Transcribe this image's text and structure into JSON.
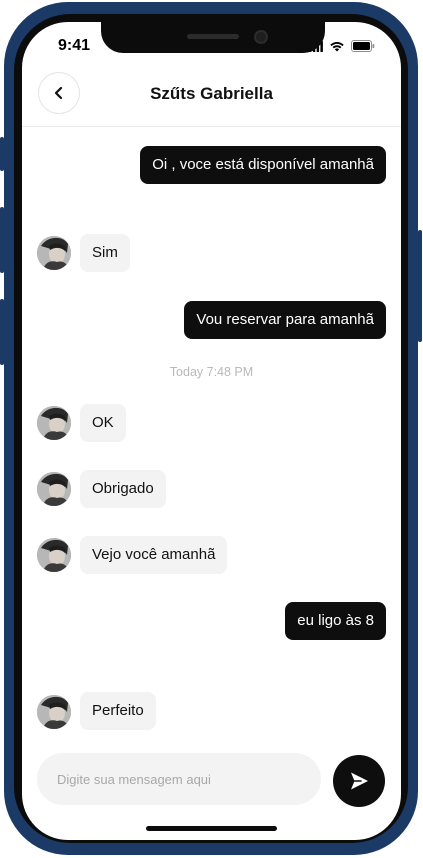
{
  "status": {
    "time": "9:41"
  },
  "header": {
    "title": "Szűts Gabriella"
  },
  "messages": [
    {
      "side": "out",
      "text": "Oi , voce está disponível amanhã"
    },
    {
      "side": "in",
      "text": "Sim"
    },
    {
      "side": "out",
      "text": "Vou reservar para amanhã"
    },
    {
      "side": "in",
      "text": "OK"
    },
    {
      "side": "in",
      "text": "Obrigado"
    },
    {
      "side": "in",
      "text": "Vejo você amanhã"
    },
    {
      "side": "out",
      "text": "eu ligo às 8"
    },
    {
      "side": "in",
      "text": "Perfeito"
    }
  ],
  "timestamp": "Today 7:48 PM",
  "composer": {
    "placeholder": "Digite sua mensagem aqui"
  },
  "icons": {
    "back": "chevron-left-icon",
    "send": "send-icon",
    "signal": "signal-icon",
    "wifi": "wifi-icon",
    "battery": "battery-icon"
  },
  "colors": {
    "chassis": "#1b3a66",
    "outgoing_bubble": "#0e0e0e",
    "incoming_bubble": "#f3f3f3"
  }
}
